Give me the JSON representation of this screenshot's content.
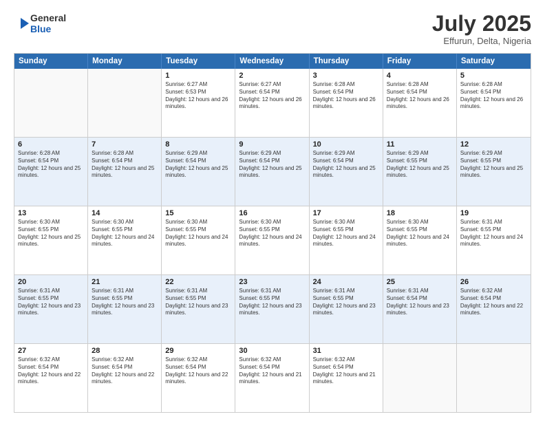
{
  "logo": {
    "line1": "General",
    "line2": "Blue"
  },
  "title": "July 2025",
  "subtitle": "Effurun, Delta, Nigeria",
  "header_days": [
    "Sunday",
    "Monday",
    "Tuesday",
    "Wednesday",
    "Thursday",
    "Friday",
    "Saturday"
  ],
  "weeks": [
    [
      {
        "day": "",
        "sunrise": "",
        "sunset": "",
        "daylight": ""
      },
      {
        "day": "",
        "sunrise": "",
        "sunset": "",
        "daylight": ""
      },
      {
        "day": "1",
        "sunrise": "Sunrise: 6:27 AM",
        "sunset": "Sunset: 6:53 PM",
        "daylight": "Daylight: 12 hours and 26 minutes."
      },
      {
        "day": "2",
        "sunrise": "Sunrise: 6:27 AM",
        "sunset": "Sunset: 6:54 PM",
        "daylight": "Daylight: 12 hours and 26 minutes."
      },
      {
        "day": "3",
        "sunrise": "Sunrise: 6:28 AM",
        "sunset": "Sunset: 6:54 PM",
        "daylight": "Daylight: 12 hours and 26 minutes."
      },
      {
        "day": "4",
        "sunrise": "Sunrise: 6:28 AM",
        "sunset": "Sunset: 6:54 PM",
        "daylight": "Daylight: 12 hours and 26 minutes."
      },
      {
        "day": "5",
        "sunrise": "Sunrise: 6:28 AM",
        "sunset": "Sunset: 6:54 PM",
        "daylight": "Daylight: 12 hours and 26 minutes."
      }
    ],
    [
      {
        "day": "6",
        "sunrise": "Sunrise: 6:28 AM",
        "sunset": "Sunset: 6:54 PM",
        "daylight": "Daylight: 12 hours and 25 minutes."
      },
      {
        "day": "7",
        "sunrise": "Sunrise: 6:28 AM",
        "sunset": "Sunset: 6:54 PM",
        "daylight": "Daylight: 12 hours and 25 minutes."
      },
      {
        "day": "8",
        "sunrise": "Sunrise: 6:29 AM",
        "sunset": "Sunset: 6:54 PM",
        "daylight": "Daylight: 12 hours and 25 minutes."
      },
      {
        "day": "9",
        "sunrise": "Sunrise: 6:29 AM",
        "sunset": "Sunset: 6:54 PM",
        "daylight": "Daylight: 12 hours and 25 minutes."
      },
      {
        "day": "10",
        "sunrise": "Sunrise: 6:29 AM",
        "sunset": "Sunset: 6:54 PM",
        "daylight": "Daylight: 12 hours and 25 minutes."
      },
      {
        "day": "11",
        "sunrise": "Sunrise: 6:29 AM",
        "sunset": "Sunset: 6:55 PM",
        "daylight": "Daylight: 12 hours and 25 minutes."
      },
      {
        "day": "12",
        "sunrise": "Sunrise: 6:29 AM",
        "sunset": "Sunset: 6:55 PM",
        "daylight": "Daylight: 12 hours and 25 minutes."
      }
    ],
    [
      {
        "day": "13",
        "sunrise": "Sunrise: 6:30 AM",
        "sunset": "Sunset: 6:55 PM",
        "daylight": "Daylight: 12 hours and 25 minutes."
      },
      {
        "day": "14",
        "sunrise": "Sunrise: 6:30 AM",
        "sunset": "Sunset: 6:55 PM",
        "daylight": "Daylight: 12 hours and 24 minutes."
      },
      {
        "day": "15",
        "sunrise": "Sunrise: 6:30 AM",
        "sunset": "Sunset: 6:55 PM",
        "daylight": "Daylight: 12 hours and 24 minutes."
      },
      {
        "day": "16",
        "sunrise": "Sunrise: 6:30 AM",
        "sunset": "Sunset: 6:55 PM",
        "daylight": "Daylight: 12 hours and 24 minutes."
      },
      {
        "day": "17",
        "sunrise": "Sunrise: 6:30 AM",
        "sunset": "Sunset: 6:55 PM",
        "daylight": "Daylight: 12 hours and 24 minutes."
      },
      {
        "day": "18",
        "sunrise": "Sunrise: 6:30 AM",
        "sunset": "Sunset: 6:55 PM",
        "daylight": "Daylight: 12 hours and 24 minutes."
      },
      {
        "day": "19",
        "sunrise": "Sunrise: 6:31 AM",
        "sunset": "Sunset: 6:55 PM",
        "daylight": "Daylight: 12 hours and 24 minutes."
      }
    ],
    [
      {
        "day": "20",
        "sunrise": "Sunrise: 6:31 AM",
        "sunset": "Sunset: 6:55 PM",
        "daylight": "Daylight: 12 hours and 23 minutes."
      },
      {
        "day": "21",
        "sunrise": "Sunrise: 6:31 AM",
        "sunset": "Sunset: 6:55 PM",
        "daylight": "Daylight: 12 hours and 23 minutes."
      },
      {
        "day": "22",
        "sunrise": "Sunrise: 6:31 AM",
        "sunset": "Sunset: 6:55 PM",
        "daylight": "Daylight: 12 hours and 23 minutes."
      },
      {
        "day": "23",
        "sunrise": "Sunrise: 6:31 AM",
        "sunset": "Sunset: 6:55 PM",
        "daylight": "Daylight: 12 hours and 23 minutes."
      },
      {
        "day": "24",
        "sunrise": "Sunrise: 6:31 AM",
        "sunset": "Sunset: 6:55 PM",
        "daylight": "Daylight: 12 hours and 23 minutes."
      },
      {
        "day": "25",
        "sunrise": "Sunrise: 6:31 AM",
        "sunset": "Sunset: 6:54 PM",
        "daylight": "Daylight: 12 hours and 23 minutes."
      },
      {
        "day": "26",
        "sunrise": "Sunrise: 6:32 AM",
        "sunset": "Sunset: 6:54 PM",
        "daylight": "Daylight: 12 hours and 22 minutes."
      }
    ],
    [
      {
        "day": "27",
        "sunrise": "Sunrise: 6:32 AM",
        "sunset": "Sunset: 6:54 PM",
        "daylight": "Daylight: 12 hours and 22 minutes."
      },
      {
        "day": "28",
        "sunrise": "Sunrise: 6:32 AM",
        "sunset": "Sunset: 6:54 PM",
        "daylight": "Daylight: 12 hours and 22 minutes."
      },
      {
        "day": "29",
        "sunrise": "Sunrise: 6:32 AM",
        "sunset": "Sunset: 6:54 PM",
        "daylight": "Daylight: 12 hours and 22 minutes."
      },
      {
        "day": "30",
        "sunrise": "Sunrise: 6:32 AM",
        "sunset": "Sunset: 6:54 PM",
        "daylight": "Daylight: 12 hours and 21 minutes."
      },
      {
        "day": "31",
        "sunrise": "Sunrise: 6:32 AM",
        "sunset": "Sunset: 6:54 PM",
        "daylight": "Daylight: 12 hours and 21 minutes."
      },
      {
        "day": "",
        "sunrise": "",
        "sunset": "",
        "daylight": ""
      },
      {
        "day": "",
        "sunrise": "",
        "sunset": "",
        "daylight": ""
      }
    ]
  ],
  "alt_rows": [
    1,
    3
  ]
}
